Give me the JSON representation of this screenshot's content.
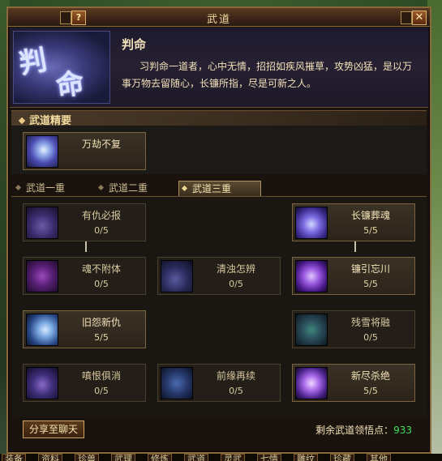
{
  "window": {
    "title": "武道",
    "help_label": "?",
    "close_label": "✕"
  },
  "skill": {
    "portrait_glyph_1": "判",
    "portrait_glyph_2": "命",
    "name": "判命",
    "description": "习判命一道者，心中无情，招招如疾风摧草，攻势凶猛，是以万事万物去留随心，长镰所指，尽是可新之人。"
  },
  "essence": {
    "section_title": "武道精要",
    "card": {
      "name": "万劫不复"
    }
  },
  "tabs": [
    {
      "label": "武道一重",
      "active": false
    },
    {
      "label": "武道二重",
      "active": false
    },
    {
      "label": "武道三重",
      "active": true
    }
  ],
  "tree": [
    {
      "name": "有仇必报",
      "count": "0/5",
      "lit": false
    },
    {
      "name": "长镰葬魂",
      "count": "5/5",
      "lit": true
    },
    {
      "name": "魂不附体",
      "count": "0/5",
      "lit": false
    },
    {
      "name": "清浊怎辨",
      "count": "0/5",
      "lit": false
    },
    {
      "name": "镰引忘川",
      "count": "5/5",
      "lit": true
    },
    {
      "name": "旧怨新仇",
      "count": "5/5",
      "lit": true
    },
    {
      "name": "残雪将融",
      "count": "0/5",
      "lit": false
    },
    {
      "name": "嗔恨俱消",
      "count": "0/5",
      "lit": false
    },
    {
      "name": "前缘再续",
      "count": "0/5",
      "lit": false
    },
    {
      "name": "新尽杀绝",
      "count": "5/5",
      "lit": true
    }
  ],
  "footer": {
    "share_label": "分享至聊天",
    "points_label": "剩余武道领悟点：",
    "points_value": "933"
  },
  "bottom_tabs": [
    "装备",
    "资料",
    "珍兽",
    "武理",
    "修炼",
    "武道",
    "灵武",
    "七情",
    "雕纹",
    "珍藏",
    "其他"
  ],
  "colors": {
    "frame": "#8a6a3a",
    "points_value": "#3ce05a",
    "text": "#f2e2b8"
  }
}
